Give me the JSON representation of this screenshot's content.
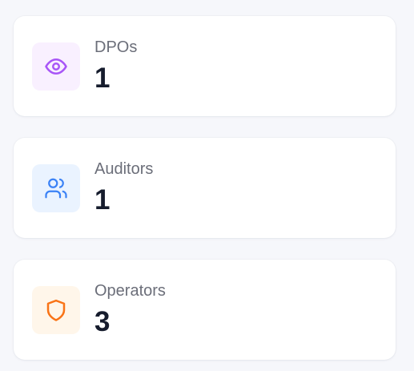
{
  "cards": [
    {
      "label": "DPOs",
      "count": "1",
      "icon": "eye-icon",
      "icon_color": "#a855f7",
      "icon_bg": "#f9f0ff"
    },
    {
      "label": "Auditors",
      "count": "1",
      "icon": "users-icon",
      "icon_color": "#3b82f6",
      "icon_bg": "#eaf3ff"
    },
    {
      "label": "Operators",
      "count": "3",
      "icon": "shield-icon",
      "icon_color": "#f97316",
      "icon_bg": "#fff6ea"
    }
  ]
}
